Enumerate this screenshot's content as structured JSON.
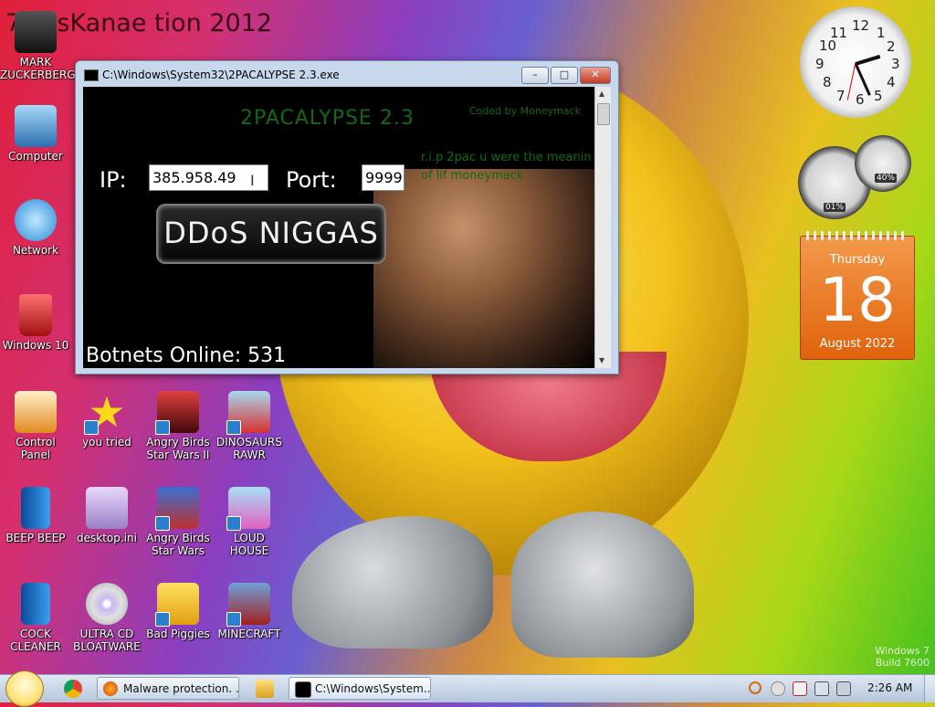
{
  "banner_text": "7 ossKanae tion 2012",
  "desktop_icons": [
    {
      "label": "MARK ZUCKERBERG",
      "icon": "person-icon"
    },
    {
      "label": "Computer",
      "icon": "computer-icon"
    },
    {
      "label": "Network",
      "icon": "network-icon"
    },
    {
      "label": "Windows 10",
      "icon": "recycle-bin-icon"
    },
    {
      "label": "Control Panel",
      "icon": "control-panel-icon"
    },
    {
      "label": "you tried",
      "icon": "star-icon"
    },
    {
      "label": "Angry Birds Star Wars II",
      "icon": "angry-birds-icon"
    },
    {
      "label": "DINOSAURS RAWR",
      "icon": "angry-birds-icon"
    },
    {
      "label": "BEEP BEEP",
      "icon": "book-icon"
    },
    {
      "label": "desktop.ini",
      "icon": "settings-file-icon"
    },
    {
      "label": "Angry Birds Star Wars",
      "icon": "angry-birds-icon"
    },
    {
      "label": "LOUD HOUSE",
      "icon": "angry-birds-icon"
    },
    {
      "label": "COCK CLEANER",
      "icon": "book-icon"
    },
    {
      "label": "ULTRA CD BLOATWARE",
      "icon": "cd-icon"
    },
    {
      "label": "Bad Piggies",
      "icon": "pig-icon"
    },
    {
      "label": "MINECRAFT",
      "icon": "minecraft-icon"
    }
  ],
  "window": {
    "title": "C:\\Windows\\System32\\2PACALYPSE 2.3.exe",
    "minimize": "–",
    "maximize": "□",
    "close": "✕"
  },
  "app": {
    "title": "2PACALYPSE  2.3",
    "coded_by": "Coded by Moneymack",
    "tribute": "r.i.p 2pac u were the meanin of lif  moneymack",
    "ip_label": "IP:",
    "ip_value": "385.958.49",
    "port_label": "Port:",
    "port_value": "9999",
    "button_label": "DDoS NIGGAS",
    "botnets_text": "Botnets Online: 531"
  },
  "gadgets": {
    "cpu_meter": "01%",
    "mem_meter": "40%",
    "calendar": {
      "weekday": "Thursday",
      "day": "18",
      "month_year": "August 2022"
    }
  },
  "taskbar": {
    "tasks": [
      {
        "label": "Malware protection. ..."
      },
      {
        "label": "C:\\Windows\\System..."
      }
    ],
    "time": "2:26 AM"
  },
  "watermark": {
    "line1": "Windows 7",
    "line2": "Build 7600"
  },
  "colors": {
    "console_text": "#0f6a12",
    "calendar": "#e0620c",
    "close_button": "#c53820"
  }
}
